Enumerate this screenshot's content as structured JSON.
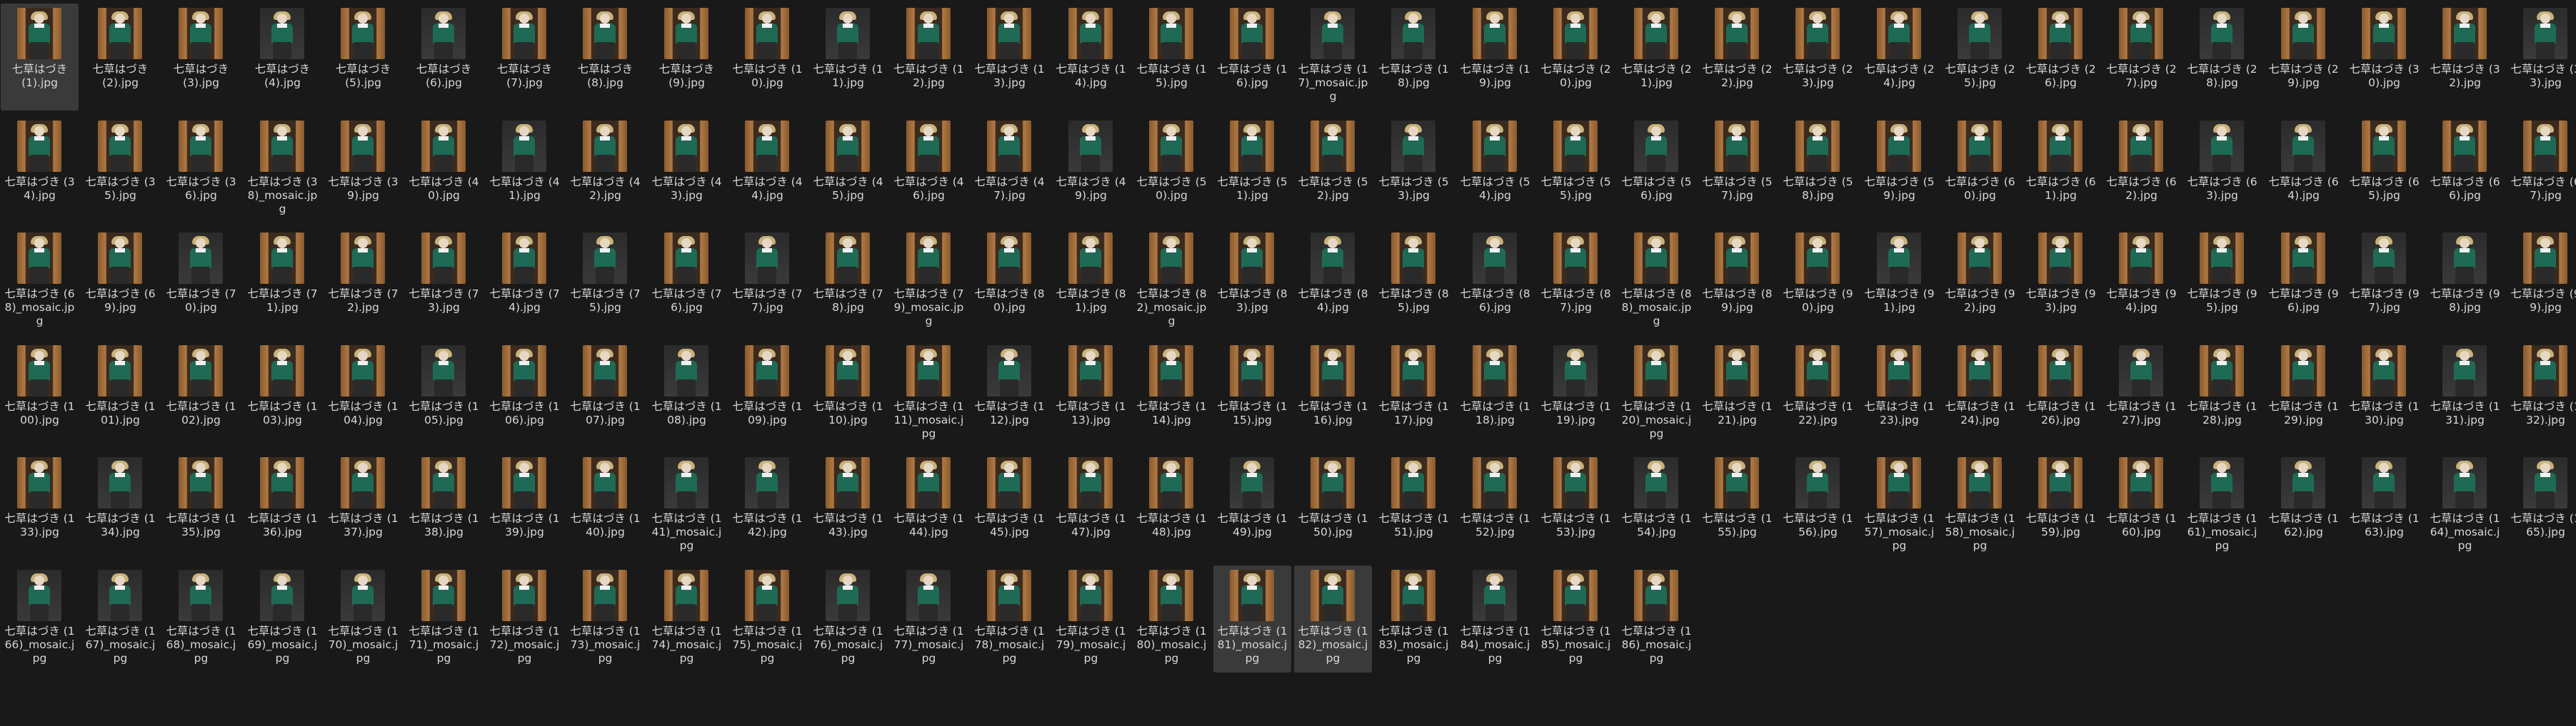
{
  "window": {
    "view": "file-explorer-large-icons",
    "background": "#191919"
  },
  "files": [
    "七草はづき (1).jpg",
    "七草はづき (2).jpg",
    "七草はづき (3).jpg",
    "七草はづき (4).jpg",
    "七草はづき (5).jpg",
    "七草はづき (6).jpg",
    "七草はづき (7).jpg",
    "七草はづき (8).jpg",
    "七草はづき (9).jpg",
    "七草はづき (10).jpg",
    "七草はづき (11).jpg",
    "七草はづき (12).jpg",
    "七草はづき (13).jpg",
    "七草はづき (14).jpg",
    "七草はづき (15).jpg",
    "七草はづき (16).jpg",
    "七草はづき (17)_mosaic.jpg",
    "七草はづき (18).jpg",
    "七草はづき (19).jpg",
    "七草はづき (20).jpg",
    "七草はづき (21).jpg",
    "七草はづき (22).jpg",
    "七草はづき (23).jpg",
    "七草はづき (24).jpg",
    "七草はづき (25).jpg",
    "七草はづき (26).jpg",
    "七草はづき (27).jpg",
    "七草はづき (28).jpg",
    "七草はづき (29).jpg",
    "七草はづき (30).jpg",
    "七草はづき (32).jpg",
    "七草はづき (33).jpg",
    "七草はづき (34).jpg",
    "七草はづき (35).jpg",
    "七草はづき (36).jpg",
    "七草はづき (38)_mosaic.jpg",
    "七草はづき (39).jpg",
    "七草はづき (40).jpg",
    "七草はづき (41).jpg",
    "七草はづき (42).jpg",
    "七草はづき (43).jpg",
    "七草はづき (44).jpg",
    "七草はづき (45).jpg",
    "七草はづき (46).jpg",
    "七草はづき (47).jpg",
    "七草はづき (49).jpg",
    "七草はづき (50).jpg",
    "七草はづき (51).jpg",
    "七草はづき (52).jpg",
    "七草はづき (53).jpg",
    "七草はづき (54).jpg",
    "七草はづき (55).jpg",
    "七草はづき (56).jpg",
    "七草はづき (57).jpg",
    "七草はづき (58).jpg",
    "七草はづき (59).jpg",
    "七草はづき (60).jpg",
    "七草はづき (61).jpg",
    "七草はづき (62).jpg",
    "七草はづき (63).jpg",
    "七草はづき (64).jpg",
    "七草はづき (65).jpg",
    "七草はづき (66).jpg",
    "七草はづき (67).jpg",
    "七草はづき (68)_mosaic.jpg",
    "七草はづき (69).jpg",
    "七草はづき (70).jpg",
    "七草はづき (71).jpg",
    "七草はづき (72).jpg",
    "七草はづき (73).jpg",
    "七草はづき (74).jpg",
    "七草はづき (75).jpg",
    "七草はづき (76).jpg",
    "七草はづき (77).jpg",
    "七草はづき (78).jpg",
    "七草はづき (79)_mosaic.jpg",
    "七草はづき (80).jpg",
    "七草はづき (81).jpg",
    "七草はづき (82)_mosaic.jpg",
    "七草はづき (83).jpg",
    "七草はづき (84).jpg",
    "七草はづき (85).jpg",
    "七草はづき (86).jpg",
    "七草はづき (87).jpg",
    "七草はづき (88)_mosaic.jpg",
    "七草はづき (89).jpg",
    "七草はづき (90).jpg",
    "七草はづき (91).jpg",
    "七草はづき (92).jpg",
    "七草はづき (93).jpg",
    "七草はづき (94).jpg",
    "七草はづき (95).jpg",
    "七草はづき (96).jpg",
    "七草はづき (97).jpg",
    "七草はづき (98).jpg",
    "七草はづき (99).jpg",
    "七草はづき (100).jpg",
    "七草はづき (101).jpg",
    "七草はづき (102).jpg",
    "七草はづき (103).jpg",
    "七草はづき (104).jpg",
    "七草はづき (105).jpg",
    "七草はづき (106).jpg",
    "七草はづき (107).jpg",
    "七草はづき (108).jpg",
    "七草はづき (109).jpg",
    "七草はづき (110).jpg",
    "七草はづき (111)_mosaic.jpg",
    "七草はづき (112).jpg",
    "七草はづき (113).jpg",
    "七草はづき (114).jpg",
    "七草はづき (115).jpg",
    "七草はづき (116).jpg",
    "七草はづき (117).jpg",
    "七草はづき (118).jpg",
    "七草はづき (119).jpg",
    "七草はづき (120)_mosaic.jpg",
    "七草はづき (121).jpg",
    "七草はづき (122).jpg",
    "七草はづき (123).jpg",
    "七草はづき (124).jpg",
    "七草はづき (126).jpg",
    "七草はづき (127).jpg",
    "七草はづき (128).jpg",
    "七草はづき (129).jpg",
    "七草はづき (130).jpg",
    "七草はづき (131).jpg",
    "七草はづき (132).jpg",
    "七草はづき (133).jpg",
    "七草はづき (134).jpg",
    "七草はづき (135).jpg",
    "七草はづき (136).jpg",
    "七草はづき (137).jpg",
    "七草はづき (138).jpg",
    "七草はづき (139).jpg",
    "七草はづき (140).jpg",
    "七草はづき (141)_mosaic.jpg",
    "七草はづき (142).jpg",
    "七草はづき (143).jpg",
    "七草はづき (144).jpg",
    "七草はづき (145).jpg",
    "七草はづき (147).jpg",
    "七草はづき (148).jpg",
    "七草はづき (149).jpg",
    "七草はづき (150).jpg",
    "七草はづき (151).jpg",
    "七草はづき (152).jpg",
    "七草はづき (153).jpg",
    "七草はづき (154).jpg",
    "七草はづき (155).jpg",
    "七草はづき (156).jpg",
    "七草はづき (157)_mosaic.jpg",
    "七草はづき (158)_mosaic.jpg",
    "七草はづき (159).jpg",
    "七草はづき (160).jpg",
    "七草はづき (161)_mosaic.jpg",
    "七草はづき (162).jpg",
    "七草はづき (163).jpg",
    "七草はづき (164)_mosaic.jpg",
    "七草はづき (165).jpg",
    "七草はづき (166)_mosaic.jpg",
    "七草はづき (167)_mosaic.jpg",
    "七草はづき (168)_mosaic.jpg",
    "七草はづき (169)_mosaic.jpg",
    "七草はづき (170)_mosaic.jpg",
    "七草はづき (171)_mosaic.jpg",
    "七草はづき (172)_mosaic.jpg",
    "七草はづき (173)_mosaic.jpg",
    "七草はづき (174)_mosaic.jpg",
    "七草はづき (175)_mosaic.jpg",
    "七草はづき (176)_mosaic.jpg",
    "七草はづき (177)_mosaic.jpg",
    "七草はづき (178)_mosaic.jpg",
    "七草はづき (179)_mosaic.jpg",
    "七草はづき (180)_mosaic.jpg",
    "七草はづき (181)_mosaic.jpg",
    "七草はづき (182)_mosaic.jpg",
    "七草はづき (183)_mosaic.jpg",
    "七草はづき (184)_mosaic.jpg",
    "七草はづき (185)_mosaic.jpg",
    "七草はづき (186)_mosaic.jpg"
  ],
  "selected": [
    "七草はづき (1).jpg",
    "七草はづき (181)_mosaic.jpg",
    "七草はづき (182)_mosaic.jpg"
  ],
  "colors": {
    "label_text": "#d8d8d8",
    "selection": "#3a3a3a",
    "thumb_wood": "#8a5a2e",
    "thumb_wood_light": "#b07a45",
    "thumb_dark": "#2b2b2b",
    "outfit_green": "#1f6a55",
    "hair_blonde": "#c9b27a"
  }
}
